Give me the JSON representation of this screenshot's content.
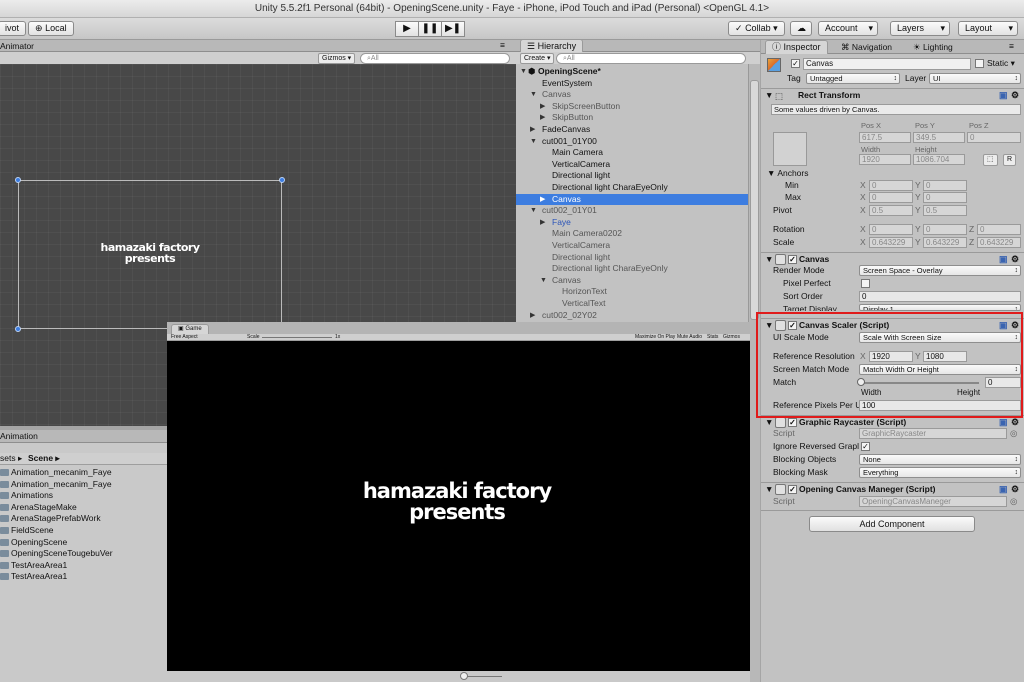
{
  "window_title": "Unity 5.5.2f1 Personal (64bit) - OpeningScene.unity - Faye - iPhone, iPod Touch and iPad (Personal) <OpenGL 4.1>",
  "toolbar": {
    "pivot": "ivot",
    "local": "Local",
    "play": "▶",
    "pause": "❚❚",
    "step": "▶❚",
    "collab": "Collab ▾",
    "account": "Account",
    "layers": "Layers",
    "layout": "Layout"
  },
  "animator": {
    "tab": "Animator",
    "gizmos": "Gizmos ▾",
    "search": "⌕All",
    "logo_line1": "hamazaki factory",
    "logo_line2": "presents"
  },
  "hierarchy": {
    "tab": "Hierarchy",
    "create": "Create ▾",
    "search": "⌕All",
    "rows": [
      {
        "label": "OpeningScene*",
        "indent": 0,
        "arrow": "▼",
        "bold": true
      },
      {
        "label": "EventSystem",
        "indent": 1,
        "arrow": ""
      },
      {
        "label": "Canvas",
        "indent": 1,
        "arrow": "▼",
        "dim": true
      },
      {
        "label": "SkipScreenButton",
        "indent": 2,
        "arrow": "▶",
        "dim": true
      },
      {
        "label": "SkipButton",
        "indent": 2,
        "arrow": "▶",
        "dim": true
      },
      {
        "label": "FadeCanvas",
        "indent": 1,
        "arrow": "▶"
      },
      {
        "label": "cut001_01Y00",
        "indent": 1,
        "arrow": "▼"
      },
      {
        "label": "Main Camera",
        "indent": 2,
        "arrow": ""
      },
      {
        "label": "VerticalCamera",
        "indent": 2,
        "arrow": ""
      },
      {
        "label": "Directional light",
        "indent": 2,
        "arrow": ""
      },
      {
        "label": "Directional light CharaEyeOnly",
        "indent": 2,
        "arrow": ""
      },
      {
        "label": "Canvas",
        "indent": 2,
        "arrow": "▶",
        "selected": true
      },
      {
        "label": "cut002_01Y01",
        "indent": 1,
        "arrow": "▼",
        "dim": true
      },
      {
        "label": "Faye",
        "indent": 2,
        "arrow": "▶",
        "dim": true,
        "blue": true
      },
      {
        "label": "Main Camera0202",
        "indent": 2,
        "arrow": "",
        "dim": true
      },
      {
        "label": "VerticalCamera",
        "indent": 2,
        "arrow": "",
        "dim": true
      },
      {
        "label": "Directional light",
        "indent": 2,
        "arrow": "",
        "dim": true
      },
      {
        "label": "Directional light CharaEyeOnly",
        "indent": 2,
        "arrow": "",
        "dim": true
      },
      {
        "label": "Canvas",
        "indent": 2,
        "arrow": "▼",
        "dim": true
      },
      {
        "label": "HorizonText",
        "indent": 3,
        "arrow": "",
        "dim": true
      },
      {
        "label": "VerticalText",
        "indent": 3,
        "arrow": "",
        "dim": true
      },
      {
        "label": "cut002_02Y02",
        "indent": 1,
        "arrow": "▶",
        "dim": true
      }
    ]
  },
  "animation_tab": "Animation",
  "project": {
    "breadcrumb_assets": "sets ▸",
    "breadcrumb_scene": "Scene ▸",
    "items": [
      "Animation_mecanim_Faye",
      "Animation_mecanim_Faye",
      "Animations",
      "ArenaStageMake",
      "ArenaStagePrefabWork",
      "FieldScene",
      "OpeningScene",
      "OpeningSceneTougebuVer",
      "TestAreaArea1",
      "TestAreaArea1"
    ]
  },
  "game": {
    "tab": "Game",
    "aspect": "Free Aspect",
    "scale_label": "Scale",
    "scale_value": "1x",
    "maximize": "Maximize On Play",
    "mute": "Mute Audio",
    "stats": "Stats",
    "gizmos": "Gizmos",
    "logo_line1": "hamazaki factory",
    "logo_line2": "presents"
  },
  "inspector": {
    "tabs": {
      "inspector": "Inspector",
      "navigation": "Navigation",
      "lighting": "Lighting"
    },
    "object_name": "Canvas",
    "static": "Static ▾",
    "tag_label": "Tag",
    "tag_value": "Untagged",
    "layer_label": "Layer",
    "layer_value": "UI",
    "rect_transform": {
      "title": "Rect Transform",
      "note": "Some values driven by Canvas.",
      "pos_x_label": "Pos X",
      "pos_y_label": "Pos Y",
      "pos_z_label": "Pos Z",
      "pos_x": "617.5",
      "pos_y": "349.5",
      "pos_z": "0",
      "width_label": "Width",
      "height_label": "Height",
      "width": "1920",
      "height": "1086.704",
      "anchors": "Anchors",
      "min": "Min",
      "max": "Max",
      "min_x": "0",
      "min_y": "0",
      "max_x": "0",
      "max_y": "0",
      "pivot": "Pivot",
      "pivot_x": "0.5",
      "pivot_y": "0.5",
      "rotation": "Rotation",
      "rot_x": "0",
      "rot_y": "0",
      "rot_z": "0",
      "scale": "Scale",
      "scale_x": "0.643229",
      "scale_y": "0.643229",
      "scale_z": "0.643229",
      "r_btn": "R",
      "x": "X",
      "y": "Y",
      "z": "Z"
    },
    "canvas": {
      "title": "Canvas",
      "render_mode_label": "Render Mode",
      "render_mode": "Screen Space - Overlay",
      "pixel_perfect": "Pixel Perfect",
      "sort_order_label": "Sort Order",
      "sort_order": "0",
      "target_display_label": "Target Display",
      "target_display": "Display 1"
    },
    "canvas_scaler": {
      "title": "Canvas Scaler (Script)",
      "ui_scale_mode_label": "UI Scale Mode",
      "ui_scale_mode": "Scale With Screen Size",
      "ref_res_label": "Reference Resolution",
      "ref_x": "1920",
      "ref_y": "1080",
      "match_mode_label": "Screen Match Mode",
      "match_mode": "Match Width Or Height",
      "match_label": "Match",
      "match_value": "0",
      "match_fraction": 0,
      "width_label": "Width",
      "height_label": "Height",
      "ref_ppu_label": "Reference Pixels Per U",
      "ref_ppu": "100"
    },
    "graphic_raycaster": {
      "title": "Graphic Raycaster (Script)",
      "script_label": "Script",
      "script_value": "GraphicRaycaster",
      "ignore_label": "Ignore Reversed Grapl",
      "blocking_objects_label": "Blocking Objects",
      "blocking_objects": "None",
      "blocking_mask_label": "Blocking Mask",
      "blocking_mask": "Everything"
    },
    "opening_manager": {
      "title": "Opening Canvas Maneger (Script)",
      "script_label": "Script",
      "script_value": "OpeningCanvasManeger"
    },
    "add_component": "Add Component"
  },
  "colors": {
    "highlight": "#e01b1b",
    "selection": "#3d7de0"
  }
}
